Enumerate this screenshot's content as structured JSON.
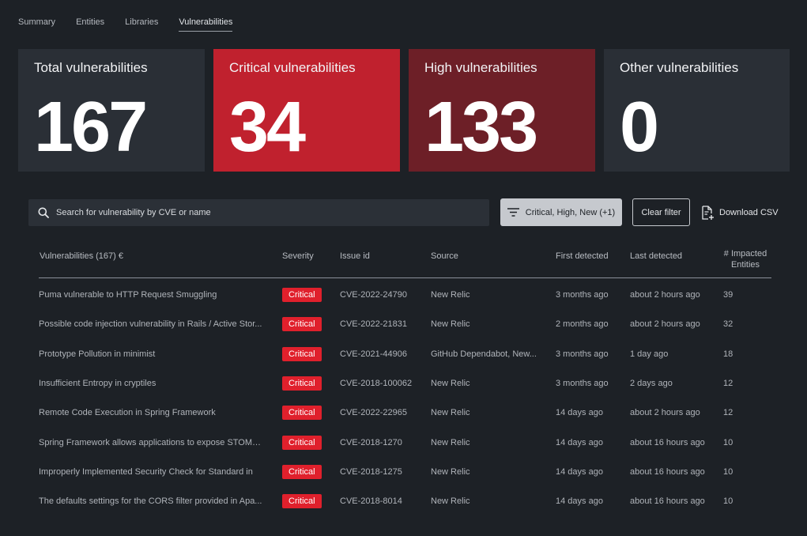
{
  "tabs": [
    {
      "label": "Summary",
      "active": false
    },
    {
      "label": "Entities",
      "active": false
    },
    {
      "label": "Libraries",
      "active": false
    },
    {
      "label": "Vulnerabilities",
      "active": true
    }
  ],
  "cards": {
    "total": {
      "title": "Total vulnerabilities",
      "value": "167"
    },
    "critical": {
      "title": "Critical vulnerabilities",
      "value": "34"
    },
    "high": {
      "title": "High vulnerabilities",
      "value": "133"
    },
    "other": {
      "title": "Other vulnerabilities",
      "value": "0"
    }
  },
  "toolbar": {
    "search_placeholder": "Search for vulnerability by CVE or name",
    "filter_label": "Critical, High, New (+1)",
    "clear_label": "Clear filter",
    "download_label": "Download CSV"
  },
  "table": {
    "headers": {
      "name": "Vulnerabilities (167) €",
      "severity": "Severity",
      "issue": "Issue id",
      "source": "Source",
      "first": "First detected",
      "last": "Last detected",
      "count_line1": "# Impacted",
      "count_line2": "Entities"
    },
    "rows": [
      {
        "name": "Puma vulnerable to HTTP Request Smuggling",
        "severity": "Critical",
        "issue": "CVE-2022-24790",
        "source": "New Relic",
        "first": "3 months ago",
        "last": "about 2 hours ago",
        "count": "39"
      },
      {
        "name": "Possible code injection vulnerability in Rails / Active Stor...",
        "severity": "Critical",
        "issue": "CVE-2022-21831",
        "source": "New Relic",
        "first": "2 months ago",
        "last": "about 2 hours ago",
        "count": "32"
      },
      {
        "name": "Prototype Pollution in minimist",
        "severity": "Critical",
        "issue": "CVE-2021-44906",
        "source": "GitHub Dependabot, New...",
        "first": "3 months ago",
        "last": "1 day ago",
        "count": "18"
      },
      {
        "name": "Insufficient Entropy in cryptiles",
        "severity": "Critical",
        "issue": "CVE-2018-100062",
        "source": "New Relic",
        "first": "3 months ago",
        "last": "2 days ago",
        "count": "12"
      },
      {
        "name": "Remote Code Execution in Spring Framework",
        "severity": "Critical",
        "issue": "CVE-2022-22965",
        "source": "New Relic",
        "first": "14 days ago",
        "last": "about 2 hours ago",
        "count": "12"
      },
      {
        "name": "Spring Framework allows applications to expose STOMP...",
        "severity": "Critical",
        "issue": "CVE-2018-1270",
        "source": "New Relic",
        "first": "14 days ago",
        "last": "about 16 hours ago",
        "count": "10"
      },
      {
        "name": "Improperly Implemented Security Check for Standard in",
        "severity": "Critical",
        "issue": "CVE-2018-1275",
        "source": "New Relic",
        "first": "14 days ago",
        "last": "about 16 hours ago",
        "count": "10"
      },
      {
        "name": "The defaults settings for the CORS filter provided in Apa...",
        "severity": "Critical",
        "issue": "CVE-2018-8014",
        "source": "New Relic",
        "first": "14 days ago",
        "last": "about 16 hours ago",
        "count": "10"
      }
    ]
  }
}
